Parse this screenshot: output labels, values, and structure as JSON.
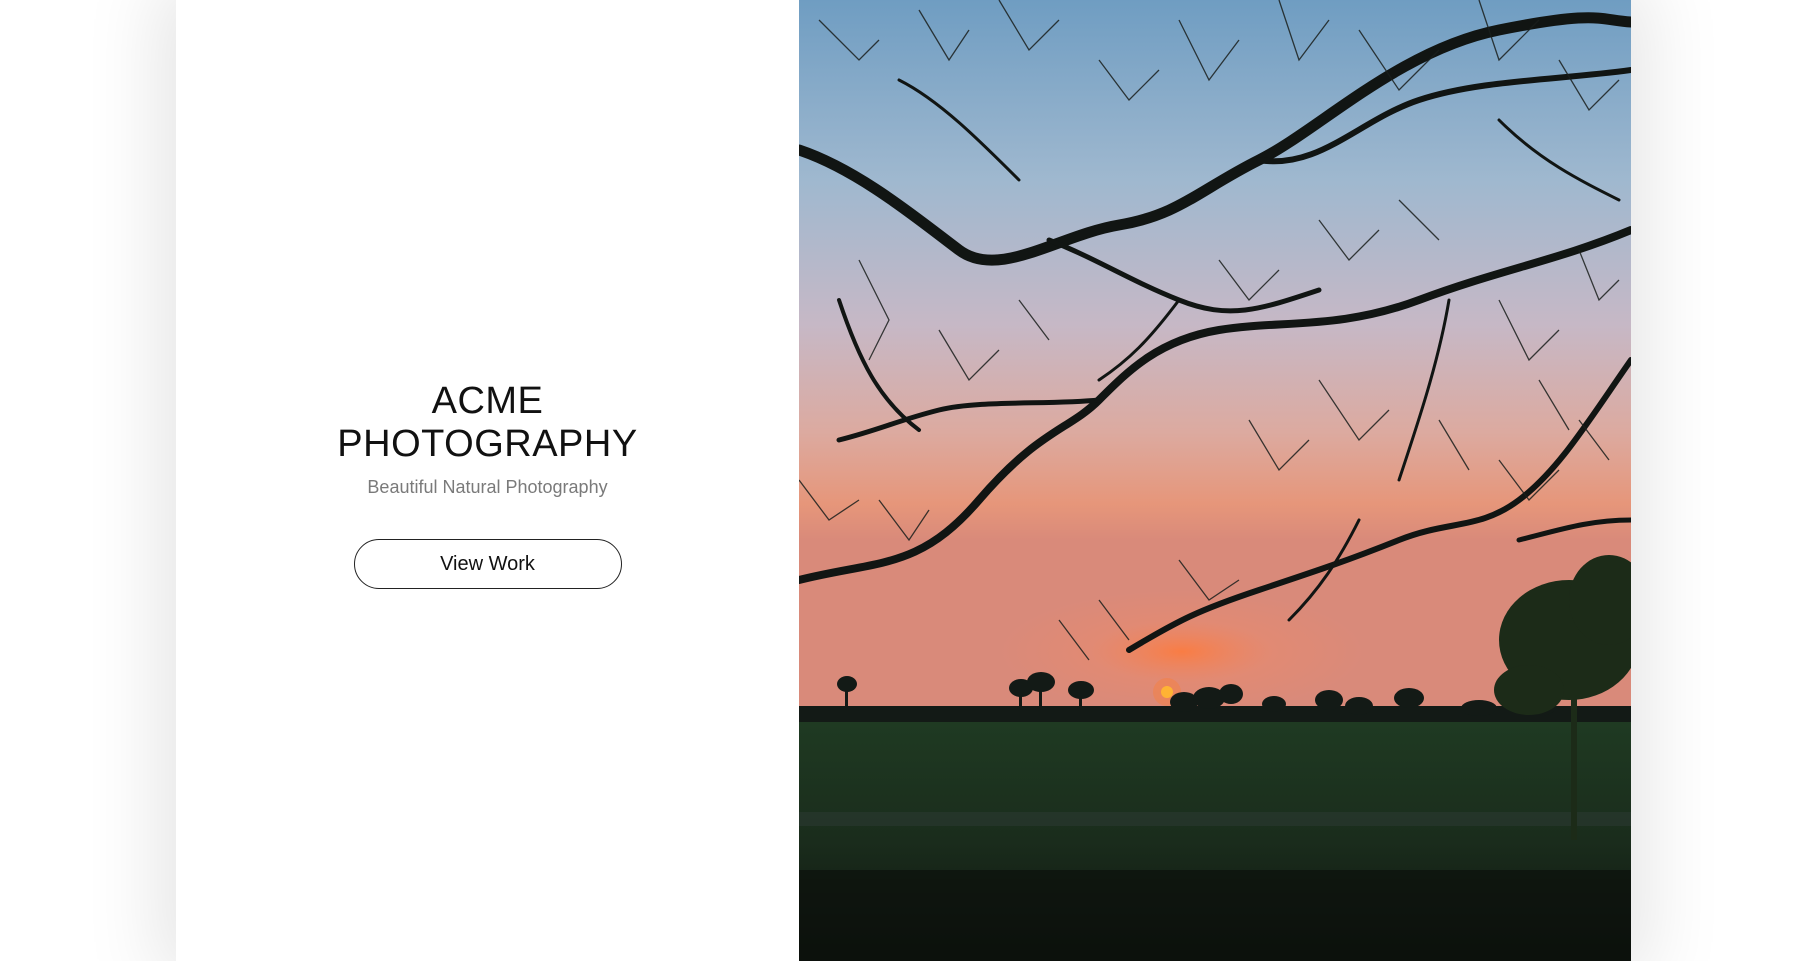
{
  "brand": {
    "title_line1": "ACME",
    "title_line2": "PHOTOGRAPHY",
    "tagline": "Beautiful Natural Photography"
  },
  "cta": {
    "label": "View Work"
  },
  "colors": {
    "sky_top": "#7ea9c9",
    "sky_mid": "#c7b6c0",
    "sky_glow": "#e39a7d",
    "sun": "#ff6a1a",
    "ground": "#1a2a1a"
  },
  "photo": {
    "subject": "sunset-tree-silhouette"
  }
}
